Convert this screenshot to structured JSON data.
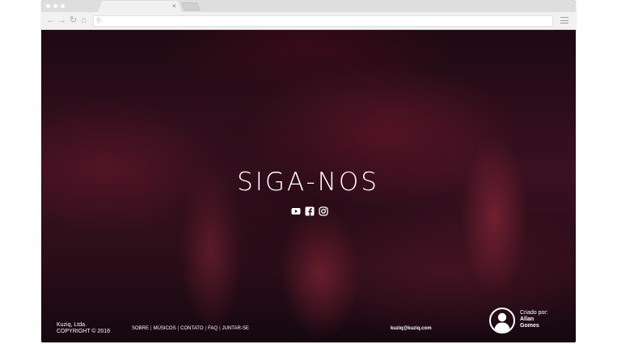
{
  "browser": {
    "tab_close": "×",
    "url_value": "",
    "nav_icons": [
      "back-arrow-icon",
      "forward-arrow-icon",
      "reload-icon",
      "home-icon"
    ]
  },
  "page": {
    "heading": "SIGA-NOS",
    "social_icons": [
      "youtube-icon",
      "facebook-icon",
      "instagram-icon"
    ],
    "footer": {
      "company": "Kuziq, Ltda.",
      "copyright": "COPYRIGHT © 2016",
      "links": [
        "SOBRE",
        "MÚSICOS",
        "CONTATO",
        "FAQ",
        "JUNTAR-SE"
      ],
      "separator": "|",
      "email": "kuziq@kuziq.com",
      "credit_label": "Criado por:",
      "credit_first": "Allan",
      "credit_last": "Gomes"
    }
  },
  "colors": {
    "hero_base": "#3a1020",
    "hero_accent": "#9a2a40",
    "chrome_bar": "#dedede",
    "toolbar": "#f1f1f1",
    "text": "#ffffff"
  }
}
